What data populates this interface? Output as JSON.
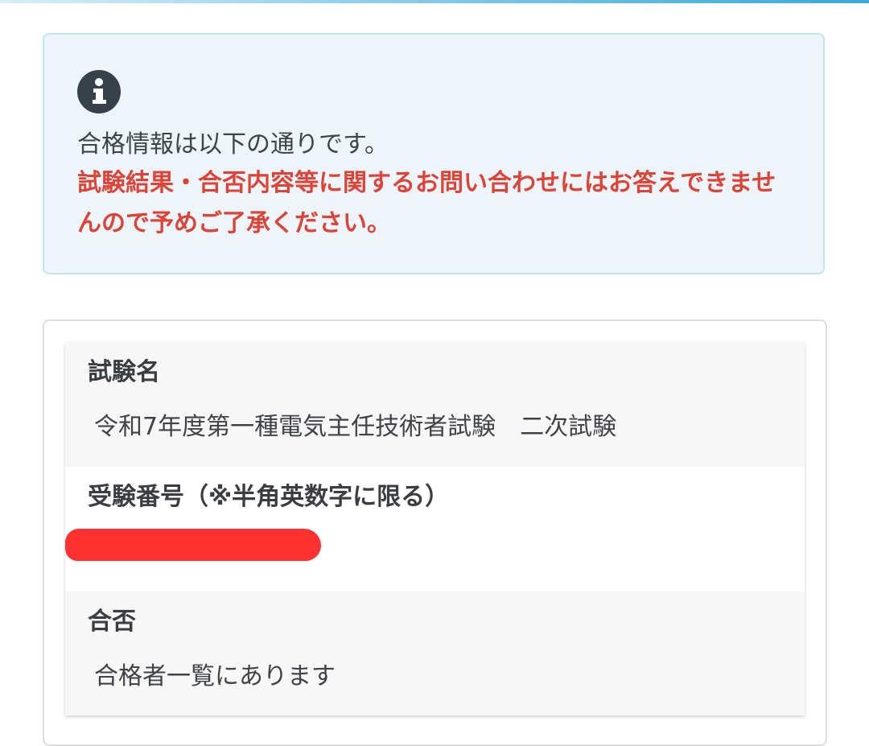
{
  "notice": {
    "icon": "info-icon",
    "message": "合格情報は以下の通りです。",
    "warning": "試験結果・合否内容等に関するお問い合わせにはお答えできませんので予めご了承ください。",
    "warning_color": "#db4437",
    "background_color": "#edf5fb"
  },
  "result": {
    "exam_name_label": "試験名",
    "exam_name_value": "令和7年度第一種電気主任技術者試験　二次試験",
    "exam_number_label": "受験番号（※半角英数字に限る）",
    "exam_number_value": "",
    "pass_label": "合否",
    "pass_value": "合格者一覧にあります"
  }
}
